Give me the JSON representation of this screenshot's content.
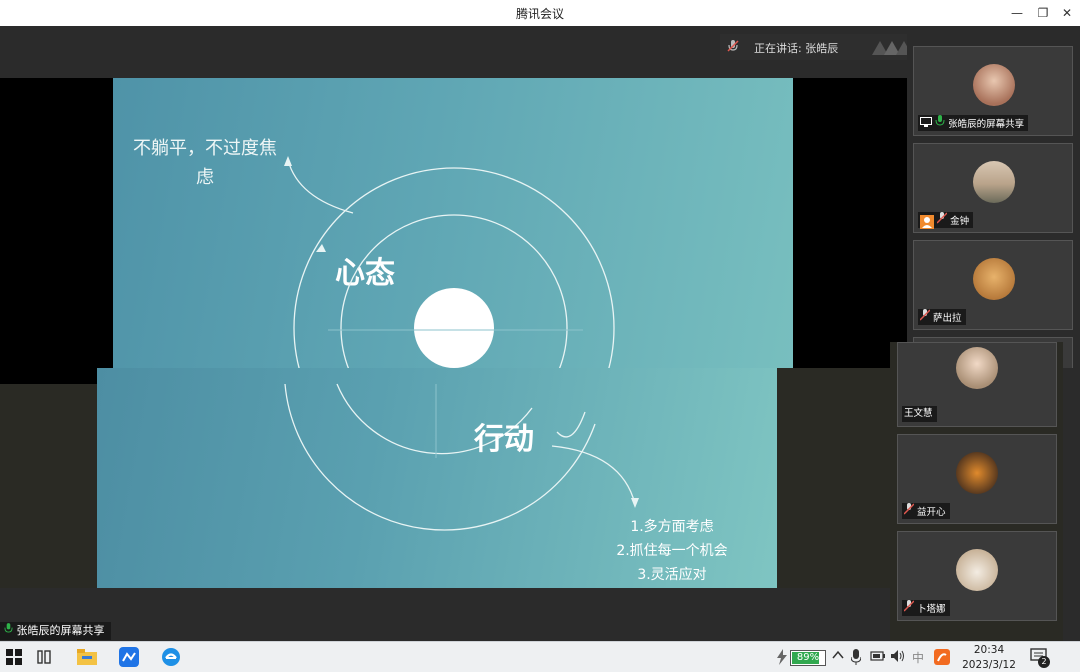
{
  "window": {
    "title": "腾讯会议",
    "minimize": "—",
    "maximize": "❐",
    "close": "✕"
  },
  "speaking": {
    "label": "正在讲话: 张皓辰"
  },
  "slide": {
    "note_top": "不躺平，不过度焦虑",
    "mindset": "心态",
    "action": "行动",
    "items": [
      "1.多方面考虑",
      "2.抓住每一个机会",
      "3.灵活应对"
    ]
  },
  "participants": [
    {
      "name": "张皓辰的屏幕共享",
      "avatar": "portrait-woman-icon",
      "mic": "on",
      "sharing": true
    },
    {
      "name": "金钟",
      "avatar": "landscape-person-icon",
      "mic": "muted",
      "badge": "user-icon"
    },
    {
      "name": "萨出拉",
      "avatar": "teddy-bear-icon",
      "mic": "muted"
    },
    {
      "name": "王文慧",
      "avatar": "flower-crown-girl-icon",
      "mic": "none"
    },
    {
      "name": "益开心",
      "avatar": "autumn-tree-icon",
      "mic": "muted"
    },
    {
      "name": "卜塔娜",
      "avatar": "cat-icon",
      "mic": "muted"
    }
  ],
  "share_label": "张皓辰的屏幕共享",
  "taskbar": {
    "battery": "89%",
    "ime": "中",
    "time": "20:34",
    "date": "2023/3/12",
    "notifications": "2"
  },
  "colors": {
    "slide_start": "#4f93a8",
    "slide_end": "#78bfbf",
    "mic_green": "#2fb34a",
    "mute_red": "#e0584f",
    "battery_green": "#31a84f"
  }
}
